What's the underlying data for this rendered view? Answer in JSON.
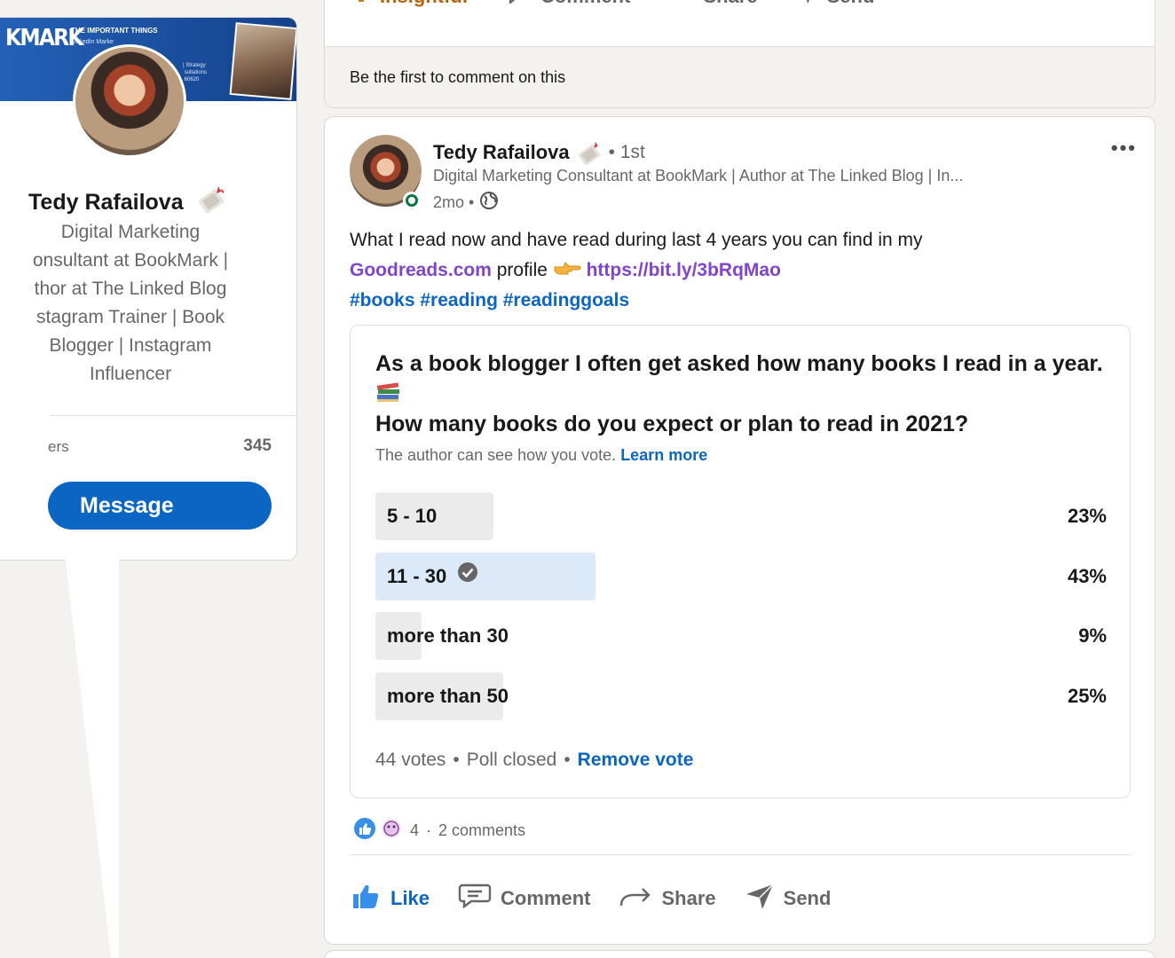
{
  "profile": {
    "banner_logo": "KMARK",
    "banner_tag": "THE IMPORTANT THINGS",
    "banner_sub": "LinkedIn Marke",
    "banner_side": "| Strategy\n sultations\n 60620",
    "name": "Tedy Rafailova",
    "headline_lines": [
      "Digital Marketing",
      "onsultant at BookMark |",
      "thor at The Linked Blog",
      "stagram Trainer | Book",
      "Blogger | Instagram",
      "Influencer"
    ],
    "followers_label": "ers",
    "followers_count": "345",
    "message_label": "Message"
  },
  "previous_post": {
    "actions": [
      "Insightful",
      "Comment",
      "Share",
      "Send"
    ],
    "footer_text": "Be the first to comment on this"
  },
  "post": {
    "author": {
      "name": "Tedy Rafailova",
      "degree": "• 1st",
      "headline": "Digital Marketing Consultant at BookMark | Author at The Linked Blog | In...",
      "time": "2mo •"
    },
    "more_label": "•••",
    "text_line1": "What I read now and have read during last 4 years you can find in my",
    "link_goodreads": "Goodreads.com",
    "text_profile": "profile",
    "link_bitly": "https://bit.ly/3bRqMao",
    "hashtags": [
      "#books",
      "#reading",
      "#readinggoals"
    ],
    "poll": {
      "question_line1": "As a book blogger I often get asked how many books I read in a year.",
      "question_line2": "How many books do you expect or plan to read in 2021?",
      "note": "The author can see how you vote.",
      "learn_more": "Learn more",
      "options": [
        {
          "label": "5 - 10",
          "pct": "23%",
          "value": 23,
          "selected": false
        },
        {
          "label": "11 - 30",
          "pct": "43%",
          "value": 43,
          "selected": true
        },
        {
          "label": "more than 30",
          "pct": "9%",
          "value": 9,
          "selected": false
        },
        {
          "label": "more than 50",
          "pct": "25%",
          "value": 25,
          "selected": false
        }
      ],
      "votes": "44 votes",
      "status": "Poll closed",
      "remove_vote": "Remove vote"
    },
    "reactions_count": "4",
    "comments_count": "2 comments",
    "actions": {
      "like": "Like",
      "comment": "Comment",
      "share": "Share",
      "send": "Send"
    }
  },
  "colors": {
    "accent": "#0a66c2",
    "link_purple": "#8344cc",
    "online": "#057642",
    "selected_fill": "#dce9f8"
  }
}
